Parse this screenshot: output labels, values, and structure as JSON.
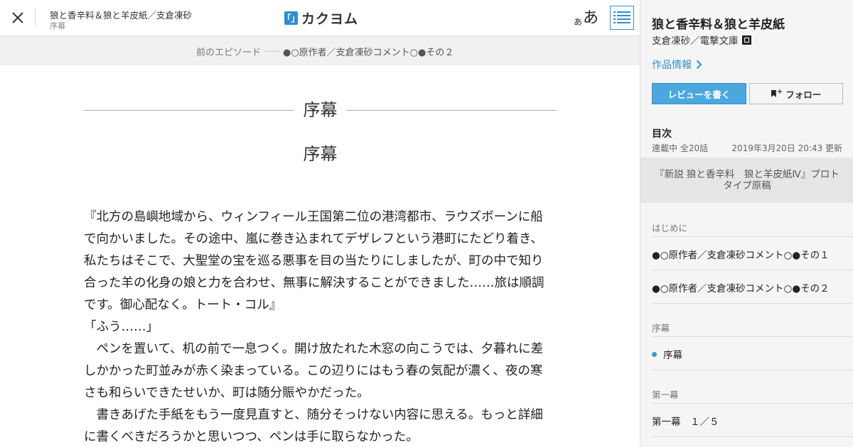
{
  "header": {
    "work_title": "狼と香辛料＆狼と羊皮紙／支倉凍砂",
    "episode_label": "序幕",
    "logo_text": "カクヨム",
    "logo_mark": "「」",
    "font_size_small": "あ",
    "font_size_large": "あ"
  },
  "prev_bar": {
    "label": "前のエピソード",
    "title": "●○原作者／支倉凍砂コメント○●その２"
  },
  "main": {
    "chapter_heading": "序幕",
    "episode_title": "序幕",
    "paragraphs": [
      "『北方の島嶼地域から、ウィンフィール王国第二位の港湾都市、ラウズボーンに船で向かいました。その途中、嵐に巻き込まれてデザレフという港町にたどり着き、私たちはそこで、大聖堂の宝を巡る悪事を目の当たりにしましたが、町の中で知り合った羊の化身の娘と力を合わせ、無事に解決することができました……旅は順調です。御心配なく。トート・コル』",
      "「ふう……」",
      "　ペンを置いて、机の前で一息つく。開け放たれた木窓の向こうでは、夕暮れに差しかかった町並みが赤く染まっている。この辺りにはもう春の気配が濃く、夜の寒さも和らいできたせいか、町は随分賑やかだった。",
      "　書きあげた手紙をもう一度見直すと、随分そっけない内容に思える。もっと詳細に書くべきだろうかと思いつつ、ペンは手に取らなかった。"
    ]
  },
  "sidebar": {
    "title": "狼と香辛料＆狼と羊皮紙",
    "author": "支倉凍砂／電撃文庫",
    "info_link": "作品情報",
    "review_button": "レビューを書く",
    "follow_button": "フォロー",
    "toc_heading": "目次",
    "status": "連載中 全20話",
    "updated": "2019年3月20日 20:43 更新",
    "collection_title": "『新説 狼と香辛料　狼と羊皮紙Ⅳ』プロトタイプ原稿",
    "sections": [
      {
        "name": "はじめに",
        "episodes": [
          "●○原作者／支倉凍砂コメント○●その１",
          "●○原作者／支倉凍砂コメント○●その２"
        ]
      },
      {
        "name": "序幕",
        "episodes": [
          "序幕"
        ]
      },
      {
        "name": "第一幕",
        "episodes": [
          "第一幕　１／５"
        ]
      }
    ],
    "current_episode": "序幕"
  },
  "colors": {
    "accent": "#2f8fd1",
    "review_button_bg": "#4ba8df",
    "sidebar_bg": "#f5f5f5",
    "prev_bar_bg": "#f1f1f1"
  }
}
